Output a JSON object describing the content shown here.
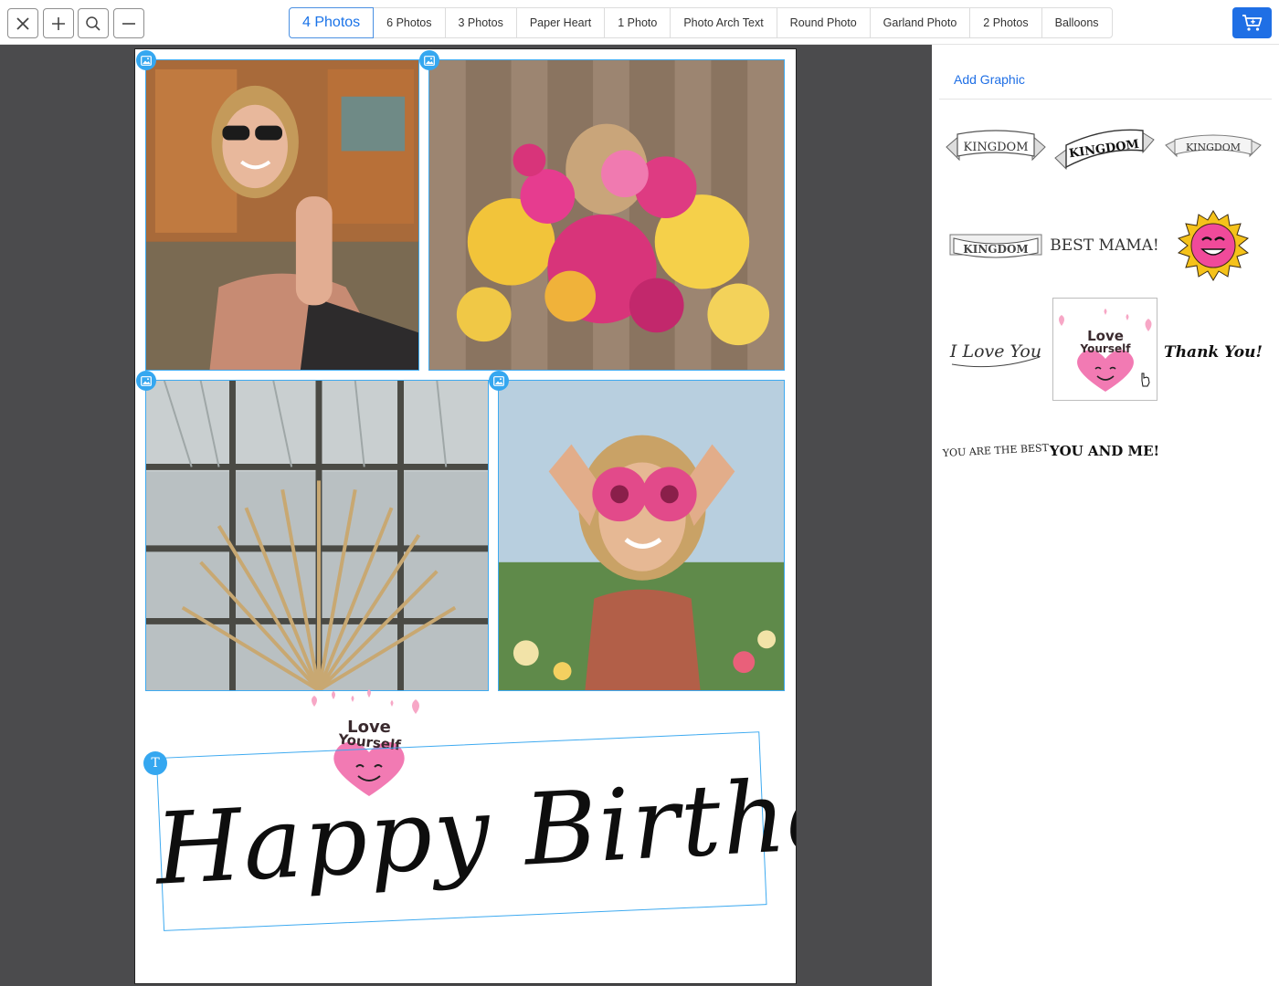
{
  "toolbar": {
    "close_icon": "close-icon",
    "zoom_in_icon": "plus-icon",
    "search_icon": "magnifier-icon",
    "zoom_out_icon": "minus-icon"
  },
  "templates": {
    "tabs": [
      {
        "label": "4 Photos",
        "active": true
      },
      {
        "label": "6 Photos",
        "active": false
      },
      {
        "label": "3 Photos",
        "active": false
      },
      {
        "label": "Paper Heart",
        "active": false
      },
      {
        "label": "1 Photo",
        "active": false
      },
      {
        "label": "Photo Arch Text",
        "active": false
      },
      {
        "label": "Round Photo",
        "active": false
      },
      {
        "label": "Garland Photo",
        "active": false
      },
      {
        "label": "2 Photos",
        "active": false
      },
      {
        "label": "Balloons",
        "active": false
      }
    ]
  },
  "cart": {
    "icon": "cart-icon",
    "color": "#1f6fe5"
  },
  "canvas": {
    "text": "Happy Birthday",
    "sticker_line1": "Love",
    "sticker_line2": "Yourself",
    "accent": "#3eaaf0",
    "text_badge": "T"
  },
  "panel": {
    "add_graphic_label": "Add Graphic",
    "graphics": [
      {
        "name": "kingdom-banner-1",
        "text": "KINGDOM"
      },
      {
        "name": "kingdom-banner-2",
        "text": "KINGDOM"
      },
      {
        "name": "kingdom-banner-3",
        "text": "KINGDOM"
      },
      {
        "name": "kingdom-banner-4",
        "text": "KINGDOM"
      },
      {
        "name": "best-mama",
        "text": "BEST MAMA!"
      },
      {
        "name": "sun-smile",
        "text": ""
      },
      {
        "name": "i-love-you",
        "text": "I Love You"
      },
      {
        "name": "love-yourself",
        "text": "Love Yourself",
        "selected": true
      },
      {
        "name": "thank-you",
        "text": "Thank You!"
      },
      {
        "name": "you-are-the-best",
        "text": "YOU ARE THE BEST"
      },
      {
        "name": "you-and-me",
        "text": "YOU AND ME!"
      }
    ]
  }
}
